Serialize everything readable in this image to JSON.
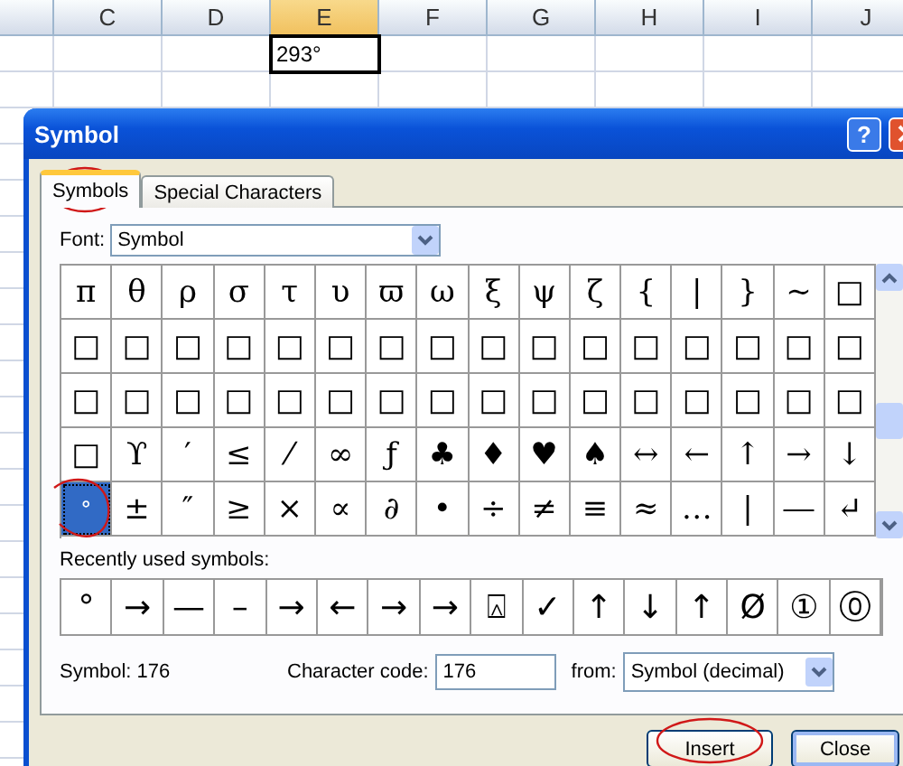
{
  "sheet": {
    "columns": [
      {
        "label": "C",
        "selected": false
      },
      {
        "label": "D",
        "selected": false
      },
      {
        "label": "E",
        "selected": true
      },
      {
        "label": "F",
        "selected": false
      },
      {
        "label": "G",
        "selected": false
      },
      {
        "label": "H",
        "selected": false
      },
      {
        "label": "I",
        "selected": false
      },
      {
        "label": "J",
        "selected": false
      }
    ],
    "active_cell": {
      "value": "293°"
    }
  },
  "window": {
    "title": "Symbol",
    "help": "?"
  },
  "tabs": [
    {
      "label": "Symbols",
      "selected": true
    },
    {
      "label": "Special Characters",
      "selected": false
    }
  ],
  "font": {
    "label": "Font:",
    "value": "Symbol"
  },
  "symbol_grid": [
    [
      {
        "symbol": "π",
        "selected": false
      },
      {
        "symbol": "θ",
        "selected": false
      },
      {
        "symbol": "ρ",
        "selected": false
      },
      {
        "symbol": "σ",
        "selected": false
      },
      {
        "symbol": "τ",
        "selected": false
      },
      {
        "symbol": "υ",
        "selected": false
      },
      {
        "symbol": "ϖ",
        "selected": false
      },
      {
        "symbol": "ω",
        "selected": false
      },
      {
        "symbol": "ξ",
        "selected": false
      },
      {
        "symbol": "ψ",
        "selected": false
      },
      {
        "symbol": "ζ",
        "selected": false
      },
      {
        "symbol": "{",
        "selected": false
      },
      {
        "symbol": "|",
        "selected": false
      },
      {
        "symbol": "}",
        "selected": false
      },
      {
        "symbol": "~",
        "selected": false
      },
      {
        "symbol": "□",
        "selected": false
      }
    ],
    [
      {
        "symbol": "□",
        "selected": false
      },
      {
        "symbol": "□",
        "selected": false
      },
      {
        "symbol": "□",
        "selected": false
      },
      {
        "symbol": "□",
        "selected": false
      },
      {
        "symbol": "□",
        "selected": false
      },
      {
        "symbol": "□",
        "selected": false
      },
      {
        "symbol": "□",
        "selected": false
      },
      {
        "symbol": "□",
        "selected": false
      },
      {
        "symbol": "□",
        "selected": false
      },
      {
        "symbol": "□",
        "selected": false
      },
      {
        "symbol": "□",
        "selected": false
      },
      {
        "symbol": "□",
        "selected": false
      },
      {
        "symbol": "□",
        "selected": false
      },
      {
        "symbol": "□",
        "selected": false
      },
      {
        "symbol": "□",
        "selected": false
      },
      {
        "symbol": "□",
        "selected": false
      }
    ],
    [
      {
        "symbol": "□",
        "selected": false
      },
      {
        "symbol": "□",
        "selected": false
      },
      {
        "symbol": "□",
        "selected": false
      },
      {
        "symbol": "□",
        "selected": false
      },
      {
        "symbol": "□",
        "selected": false
      },
      {
        "symbol": "□",
        "selected": false
      },
      {
        "symbol": "□",
        "selected": false
      },
      {
        "symbol": "□",
        "selected": false
      },
      {
        "symbol": "□",
        "selected": false
      },
      {
        "symbol": "□",
        "selected": false
      },
      {
        "symbol": "□",
        "selected": false
      },
      {
        "symbol": "□",
        "selected": false
      },
      {
        "symbol": "□",
        "selected": false
      },
      {
        "symbol": "□",
        "selected": false
      },
      {
        "symbol": "□",
        "selected": false
      },
      {
        "symbol": "□",
        "selected": false
      }
    ],
    [
      {
        "symbol": "□",
        "selected": false
      },
      {
        "symbol": "ϒ",
        "selected": false
      },
      {
        "symbol": "′",
        "selected": false
      },
      {
        "symbol": "≤",
        "selected": false
      },
      {
        "symbol": "⁄",
        "selected": false
      },
      {
        "symbol": "∞",
        "selected": false
      },
      {
        "symbol": "ƒ",
        "selected": false
      },
      {
        "symbol": "♣",
        "selected": false
      },
      {
        "symbol": "♦",
        "selected": false
      },
      {
        "symbol": "♥",
        "selected": false
      },
      {
        "symbol": "♠",
        "selected": false
      },
      {
        "symbol": "↔",
        "selected": false
      },
      {
        "symbol": "←",
        "selected": false
      },
      {
        "symbol": "↑",
        "selected": false
      },
      {
        "symbol": "→",
        "selected": false
      },
      {
        "symbol": "↓",
        "selected": false
      }
    ],
    [
      {
        "symbol": "°",
        "selected": true
      },
      {
        "symbol": "±",
        "selected": false
      },
      {
        "symbol": "″",
        "selected": false
      },
      {
        "symbol": "≥",
        "selected": false
      },
      {
        "symbol": "×",
        "selected": false
      },
      {
        "symbol": "∝",
        "selected": false
      },
      {
        "symbol": "∂",
        "selected": false
      },
      {
        "symbol": "•",
        "selected": false
      },
      {
        "symbol": "÷",
        "selected": false
      },
      {
        "symbol": "≠",
        "selected": false
      },
      {
        "symbol": "≡",
        "selected": false
      },
      {
        "symbol": "≈",
        "selected": false
      },
      {
        "symbol": "…",
        "selected": false
      },
      {
        "symbol": "|",
        "selected": false
      },
      {
        "symbol": "―",
        "selected": false
      },
      {
        "symbol": "↵",
        "selected": false
      }
    ]
  ],
  "recently_used": {
    "label": "Recently used symbols:",
    "symbols": [
      "°",
      "→",
      "—",
      "–",
      "→",
      "←",
      "→",
      "→",
      "⍓",
      "✓",
      "↑",
      "↓",
      "↑",
      "Ø",
      "①",
      "⓪"
    ]
  },
  "symbol_info": "Symbol: 176",
  "character_code": {
    "label": "Character code:",
    "value": "176"
  },
  "from": {
    "label": "from:",
    "value": "Symbol (decimal)"
  },
  "buttons": [
    "Insert",
    "Close"
  ]
}
